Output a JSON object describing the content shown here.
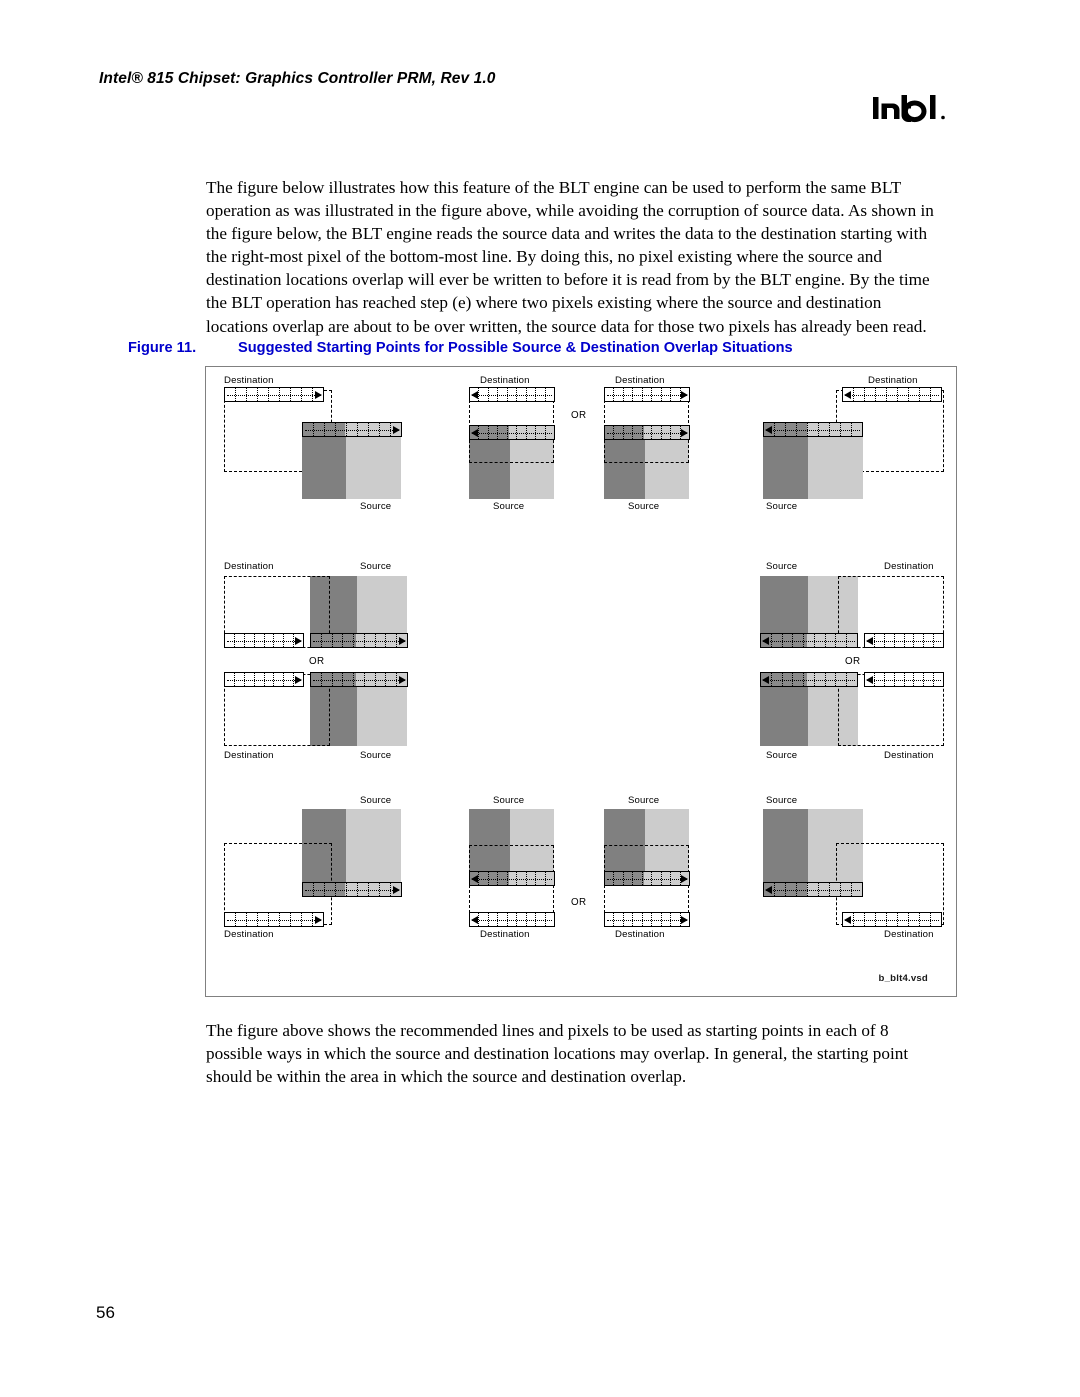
{
  "header": {
    "title": "Intel® 815 Chipset: Graphics Controller PRM, Rev 1.0",
    "logo_alt": "intel",
    "logo_text": "intel"
  },
  "body": {
    "paragraph_top": "The figure below illustrates how this feature of the BLT engine can be used to perform the same BLT operation as was illustrated in the figure above, while avoiding the corruption of source data. As shown in the figure below, the BLT engine reads the source data and writes the data to the destination starting with the right-most pixel of the bottom-most line. By doing this, no pixel existing where the source and destination locations overlap will ever be written to before it is read from by the BLT engine. By the time the BLT operation has reached step (e) where two pixels existing where the source and destination locations overlap are about to be over written, the source data for those two pixels has already been read.",
    "paragraph_bottom": "The figure above shows the recommended lines and pixels to be used as starting points in each of 8 possible ways in which the source and destination locations may overlap. In general, the starting point should be within the area in which the source and destination overlap."
  },
  "figure": {
    "number": "Figure 11.",
    "caption": "Suggested Starting Points for Possible Source & Destination Overlap Situations",
    "file_ref": "b_blt4.vsd",
    "or_label": "OR",
    "labels": {
      "destination": "Destination",
      "source": "Source"
    },
    "colors": {
      "source_dark": "#808080",
      "source_light": "#cccccc",
      "caption_blue": "#0000cc",
      "frame_gray": "#808080"
    },
    "cells": [
      {
        "id": "r1c1",
        "destination_label": "Destination",
        "source_label": "Source",
        "direction": "right",
        "arrangement": "dest-upper-left-src-lower-right"
      },
      {
        "id": "r1c2",
        "destination_label": "Destination",
        "source_label": "Source",
        "direction": "left",
        "arrangement": "dest-over-src-aligned"
      },
      {
        "id": "r1c3",
        "destination_label": "Destination",
        "source_label": "Source",
        "direction": "right",
        "arrangement": "dest-over-src-aligned"
      },
      {
        "id": "r1c4",
        "destination_label": "Destination",
        "source_label": "Source",
        "direction": "left",
        "arrangement": "src-lower-left-dest-upper-right"
      },
      {
        "id": "r2c1a",
        "destination_label": "Destination",
        "source_label": "Source",
        "direction": "right",
        "arrangement": "side-by-side-bar-bottom"
      },
      {
        "id": "r2c1b",
        "destination_label": "Destination",
        "source_label": "Source",
        "direction": "right",
        "arrangement": "side-by-side-bar-top"
      },
      {
        "id": "r2c2a",
        "destination_label": "Destination",
        "source_label": "Source",
        "direction": "left",
        "arrangement": "side-by-side-bar-bottom"
      },
      {
        "id": "r2c2b",
        "destination_label": "Destination",
        "source_label": "Source",
        "direction": "left",
        "arrangement": "side-by-side-bar-top"
      },
      {
        "id": "r3c1",
        "destination_label": "Destination",
        "source_label": "Source",
        "direction": "right",
        "arrangement": "src-upper-right-dest-lower-left"
      },
      {
        "id": "r3c2",
        "destination_label": "Destination",
        "source_label": "Source",
        "direction": "left",
        "arrangement": "src-over-dest-aligned"
      },
      {
        "id": "r3c3",
        "destination_label": "Destination",
        "source_label": "Source",
        "direction": "right",
        "arrangement": "src-over-dest-aligned"
      },
      {
        "id": "r3c4",
        "destination_label": "Destination",
        "source_label": "Source",
        "direction": "left",
        "arrangement": "src-upper-left-dest-lower-right"
      }
    ]
  },
  "footer": {
    "page_number": "56"
  }
}
